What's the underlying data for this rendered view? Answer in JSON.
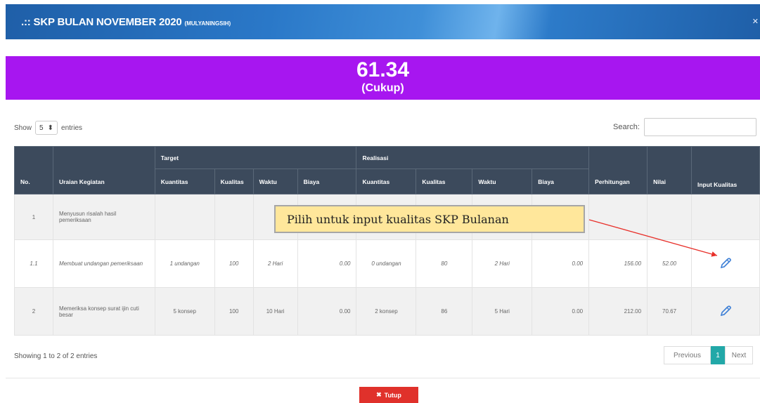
{
  "header": {
    "title": ".:: SKP BULAN NOVEMBER 2020",
    "subtitle": "(MULYANINGSIH)",
    "close_icon": "close-icon"
  },
  "score": {
    "value": "61.34",
    "category": "(Cukup)",
    "color": "#a716f0"
  },
  "length_control": {
    "show_label": "Show",
    "value": "5",
    "entries_label": "entries"
  },
  "search": {
    "label": "Search:",
    "value": ""
  },
  "table": {
    "headers": {
      "no": "No.",
      "uraian": "Uraian Kegiatan",
      "target": "Target",
      "realisasi": "Realisasi",
      "perhitungan": "Perhitungan",
      "nilai": "Nilai",
      "input": "Input Kualitas",
      "sub": [
        "Kuantitas",
        "Kualitas",
        "Waktu",
        "Biaya",
        "Kuantitas",
        "Kualitas",
        "Waktu",
        "Biaya"
      ]
    },
    "rows": [
      {
        "no": "1",
        "uraian": "Menyusun risalah hasil pemeriksaan",
        "t_kuan": "",
        "t_kual": "",
        "t_waktu": "",
        "t_biaya": "",
        "r_kuan": "",
        "r_kual": "",
        "r_waktu": "",
        "r_biaya": "",
        "perhitungan": "",
        "nilai": ""
      },
      {
        "no": "1.1",
        "uraian": "Membuat undangan pemeriksaan",
        "t_kuan": "1 undangan",
        "t_kual": "100",
        "t_waktu": "2 Hari",
        "t_biaya": "0.00",
        "r_kuan": "0 undangan",
        "r_kual": "80",
        "r_waktu": "2 Hari",
        "r_biaya": "0.00",
        "perhitungan": "156.00",
        "nilai": "52.00"
      },
      {
        "no": "2",
        "uraian": "Memeriksa konsep surat ijin cuti besar",
        "t_kuan": "5 konsep",
        "t_kual": "100",
        "t_waktu": "10 Hari",
        "t_biaya": "0.00",
        "r_kuan": "2 konsep",
        "r_kual": "86",
        "r_waktu": "5 Hari",
        "r_biaya": "0.00",
        "perhitungan": "212.00",
        "nilai": "70.67"
      }
    ]
  },
  "annotation": {
    "text": "Pilih untuk input kualitas SKP Bulanan"
  },
  "footer": {
    "info": "Showing 1 to 2 of 2 entries",
    "prev": "Previous",
    "page": "1",
    "next": "Next"
  },
  "close_button": {
    "label": "Tutup",
    "icon": "x-icon",
    "color": "#e0312b"
  }
}
